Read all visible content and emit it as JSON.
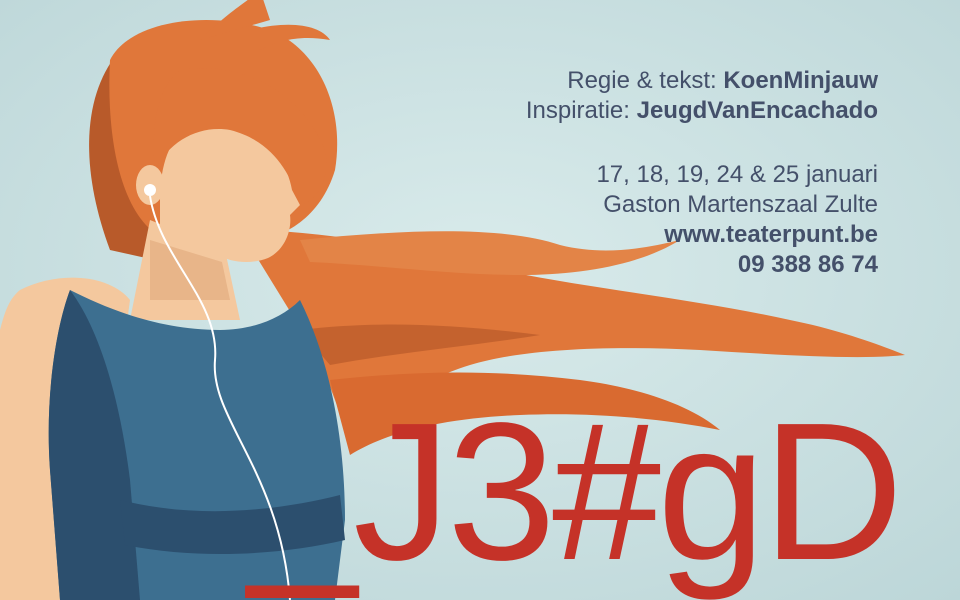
{
  "colors": {
    "background": "#cfe3e4",
    "hair": "#e0773a",
    "hair_dark": "#b85a2a",
    "skin": "#f4c89e",
    "dress": "#3d6f90",
    "dress_dark": "#2c4f6e",
    "title": "#c53228",
    "text": "#44506a"
  },
  "credits": {
    "regie_label": "Regie & tekst:",
    "regie_value": "KoenMinjauw",
    "inspiratie_label": "Inspiratie:",
    "inspiratie_value": "JeugdVanEncachado"
  },
  "details": {
    "dates": "17, 18, 19, 24 & 25 januari",
    "venue": "Gaston Martenszaal Zulte",
    "website": "www.teaterpunt.be",
    "phone": "09 388 86 74"
  },
  "title": "_J3#gD"
}
